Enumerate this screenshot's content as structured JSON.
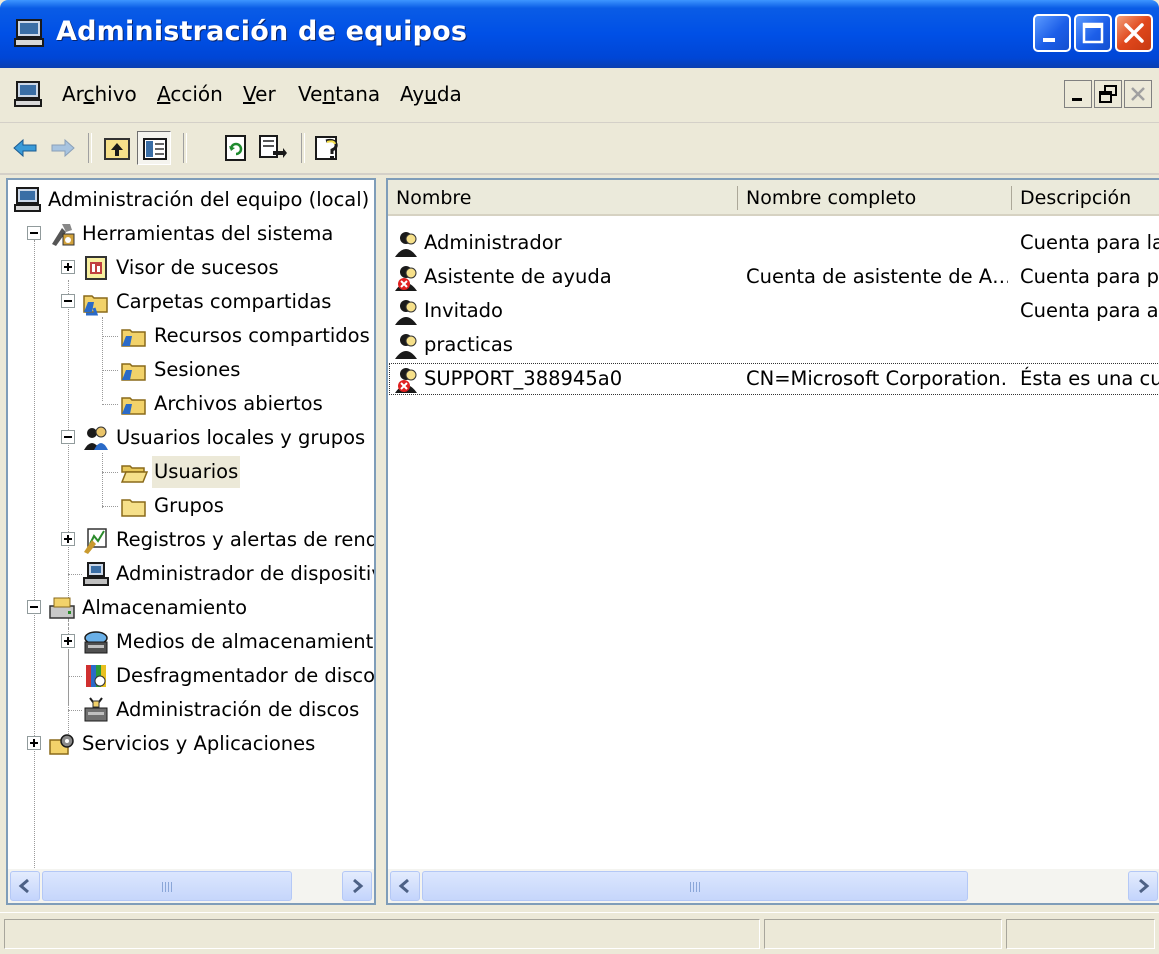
{
  "window": {
    "title": "Administración de equipos",
    "title_gradient": [
      "#3d95ff",
      "#0050e6"
    ],
    "controls": [
      "minimize-icon",
      "maximize-icon",
      "close-icon"
    ]
  },
  "menu": {
    "items": [
      {
        "label": "Archivo",
        "accel": "c"
      },
      {
        "label": "Acción",
        "accel": "A"
      },
      {
        "label": "Ver",
        "accel": "V"
      },
      {
        "label": "Ventana",
        "accel": "n"
      },
      {
        "label": "Ayuda",
        "accel": "u"
      }
    ]
  },
  "toolbar": {
    "buttons": [
      "back-arrow-icon",
      "forward-arrow-icon",
      "up-folder-icon",
      "show-hide-tree-icon",
      "refresh-icon",
      "export-list-icon",
      "help-icon"
    ]
  },
  "tree": {
    "items": [
      {
        "label": "Administración del equipo (local)",
        "icon": "computer-icon"
      },
      {
        "label": "Herramientas del sistema",
        "icon": "tools-icon"
      },
      {
        "label": "Visor de sucesos",
        "icon": "event-viewer-icon"
      },
      {
        "label": "Carpetas compartidas",
        "icon": "shared-folder-icon"
      },
      {
        "label": "Recursos compartidos",
        "icon": "shared-folder-icon"
      },
      {
        "label": "Sesiones",
        "icon": "shared-folder-icon"
      },
      {
        "label": "Archivos abiertos",
        "icon": "shared-folder-icon"
      },
      {
        "label": "Usuarios locales y grupos",
        "icon": "users-groups-icon"
      },
      {
        "label": "Usuarios",
        "icon": "folder-open-icon"
      },
      {
        "label": "Grupos",
        "icon": "folder-icon"
      },
      {
        "label": "Registros y alertas de rendim",
        "icon": "performance-logs-icon"
      },
      {
        "label": "Administrador de dispositivos",
        "icon": "device-manager-icon"
      },
      {
        "label": "Almacenamiento",
        "icon": "storage-icon"
      },
      {
        "label": "Medios de almacenamiento e",
        "icon": "removable-storage-icon"
      },
      {
        "label": "Desfragmentador de disco",
        "icon": "defrag-icon"
      },
      {
        "label": "Administración de discos",
        "icon": "disk-management-icon"
      },
      {
        "label": "Servicios y Aplicaciones",
        "icon": "services-icon"
      }
    ],
    "selected": "Usuarios"
  },
  "list": {
    "columns": [
      "Nombre",
      "Nombre completo",
      "Descripción"
    ],
    "rows": [
      {
        "name": "Administrador",
        "full_name": "",
        "description": "Cuenta para la",
        "disabled": false
      },
      {
        "name": "Asistente de ayuda",
        "full_name": "Cuenta de asistente de A…",
        "description": "Cuenta para pr",
        "disabled": true
      },
      {
        "name": "Invitado",
        "full_name": "",
        "description": "Cuenta para ac",
        "disabled": false
      },
      {
        "name": "practicas",
        "full_name": "",
        "description": "",
        "disabled": false
      },
      {
        "name": "SUPPORT_388945a0",
        "full_name": "CN=Microsoft Corporation…",
        "description": "Ésta es una cue",
        "disabled": true
      }
    ]
  }
}
